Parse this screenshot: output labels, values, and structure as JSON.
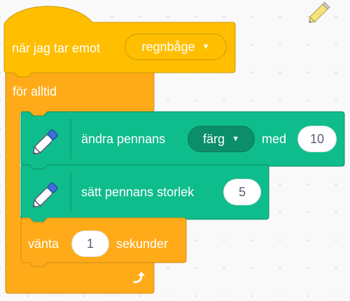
{
  "colors": {
    "event": "#ffbf00",
    "event_border": "#cc9900",
    "control": "#ffab19",
    "control_border": "#cf8b17",
    "pen": "#0fbd8c",
    "pen_border": "#0b8e69",
    "text": "#ffffff",
    "input_text": "#575e75"
  },
  "hat_block": {
    "label": "när jag tar emot",
    "message_dropdown": "regnbåge"
  },
  "forever_block": {
    "label": "för alltid",
    "loop_icon": "loop-arrow-icon"
  },
  "set_pen_color_block": {
    "label": "ändra pennans",
    "param_dropdown": "färg",
    "label_with": "med",
    "value": "10",
    "icon": "pen-icon"
  },
  "set_pen_size_block": {
    "label": "sätt pennans storlek",
    "value": "5",
    "icon": "pen-icon"
  },
  "wait_block": {
    "label": "vänta",
    "value": "1",
    "unit": "sekunder"
  },
  "toolbar_icon": "pencil-icon"
}
